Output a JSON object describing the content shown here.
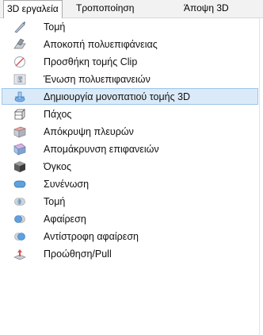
{
  "menubar": {
    "tabs": [
      {
        "label": "3D εργαλεία",
        "active": true
      },
      {
        "label": "Τροποποίηση",
        "active": false
      },
      {
        "label": "Άποψη 3D",
        "active": false
      }
    ]
  },
  "menu": {
    "selected_index": 6,
    "items": [
      {
        "label": "Τομή",
        "icon": "knife-icon"
      },
      {
        "label": "Αποκοπή πολυεπιφάνειας",
        "icon": "trim-mesh-icon"
      },
      {
        "label": "Προσθήκη τομής Clip",
        "icon": "clip-section-icon"
      },
      {
        "label": "Ένωση πολυεπιφανειών",
        "icon": "join-meshes-icon"
      },
      {
        "label": "Δημιουργία μονοπατιού τομής 3D",
        "icon": "section-path-icon"
      },
      {
        "label": "Πάχος",
        "icon": "thickness-icon"
      },
      {
        "label": "Απόκρυψη πλευρών",
        "icon": "hide-faces-icon"
      },
      {
        "label": "Απομάκρυνση επιφανειών",
        "icon": "remove-surfaces-icon"
      },
      {
        "label": "Όγκος",
        "icon": "solid-volume-icon"
      },
      {
        "label": "Συνένωση",
        "icon": "union-icon"
      },
      {
        "label": "Τομή",
        "icon": "intersect-icon"
      },
      {
        "label": "Αφαίρεση",
        "icon": "subtract-icon"
      },
      {
        "label": "Αντίστροφη αφαίρεση",
        "icon": "reverse-subtract-icon"
      },
      {
        "label": "Προώθηση/Pull",
        "icon": "push-pull-icon"
      }
    ]
  }
}
